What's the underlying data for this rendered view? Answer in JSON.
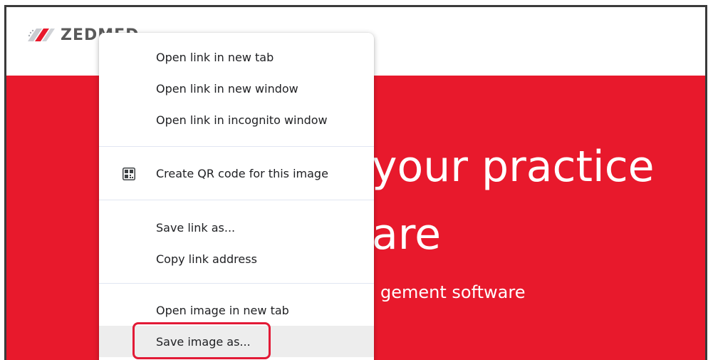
{
  "brand": {
    "logo_text": "ZEDMED"
  },
  "hero": {
    "title_line_1": "your practice",
    "title_line_2": "are",
    "subtitle": "gement software",
    "partial_line": "...",
    "background_color": "#e8192c"
  },
  "context_menu": {
    "items": [
      {
        "label": "Open link in new tab"
      },
      {
        "label": "Open link in new window"
      },
      {
        "label": "Open link in incognito window"
      },
      {
        "label": "Create QR code for this image",
        "icon": "qr-code-icon"
      },
      {
        "label": "Save link as..."
      },
      {
        "label": "Copy link address"
      },
      {
        "label": "Open image in new tab"
      },
      {
        "label": "Save image as...",
        "hovered": true,
        "highlighted": true
      }
    ]
  },
  "highlight_color": "#e21a36"
}
